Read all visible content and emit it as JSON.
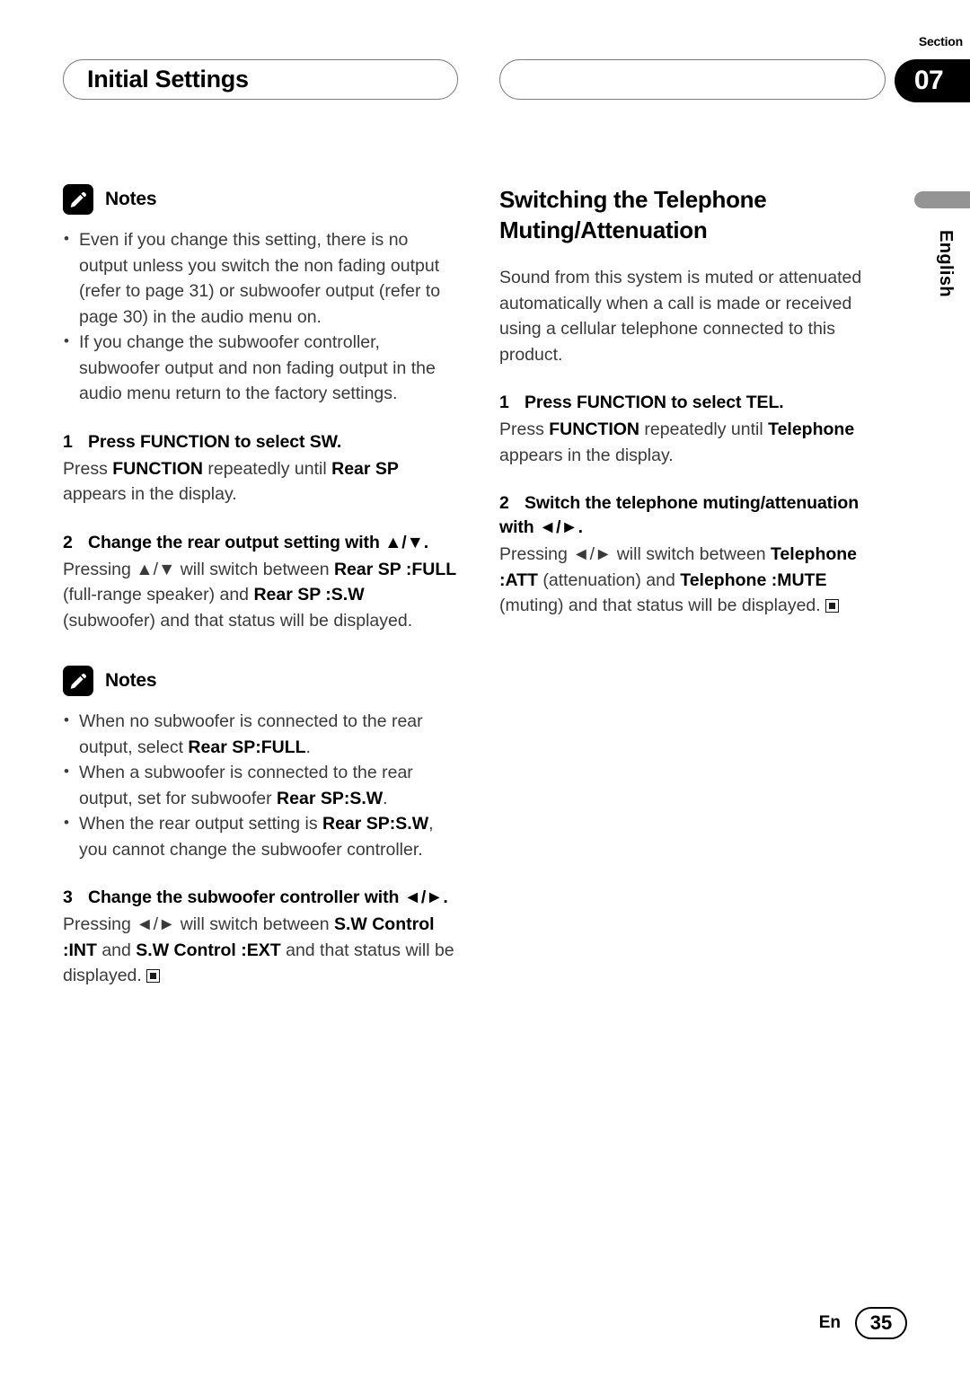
{
  "header": {
    "section_label": "Section",
    "section_number": "07",
    "left_title": "Initial Settings",
    "right_title": ""
  },
  "side_tab": {
    "language": "English"
  },
  "left_column": {
    "notes_1": {
      "icon": "pencil-icon",
      "label": "Notes",
      "bullets": [
        "Even if you change this setting, there is no output unless you switch the non fading output (refer to page 31) or subwoofer output (refer to page 30) in the audio menu on.",
        "If you change the subwoofer controller, subwoofer output and non fading output in the audio menu return to the factory settings."
      ]
    },
    "step_1": {
      "number": "1",
      "heading_parts": [
        {
          "text": "Press ",
          "bold": true
        },
        {
          "text": "FUNCTION",
          "bold": true
        },
        {
          "text": " to select SW.",
          "bold": true
        }
      ],
      "heading": "Press FUNCTION to select SW.",
      "body_html": "Press <b>FUNCTION</b> repeatedly until <b>Rear SP</b> appears in the display."
    },
    "step_2": {
      "number": "2",
      "heading": "Change the rear output setting with ▲/▼.",
      "body_html": "Pressing ▲/▼ will switch between <b>Rear SP :FULL</b> (full-range speaker) and <b>Rear SP :S.W</b> (subwoofer) and that status will be displayed."
    },
    "notes_2": {
      "icon": "pencil-icon",
      "label": "Notes",
      "bullets_html": [
        "When no subwoofer is connected to the rear output, select <b>Rear SP:FULL</b>.",
        "When a subwoofer is connected to the rear output, set for subwoofer <b>Rear SP:S.W</b>.",
        "When the rear output setting is <b>Rear SP:S.W</b>, you cannot change the subwoofer controller."
      ]
    },
    "step_3": {
      "number": "3",
      "heading": "Change the subwoofer controller with ◄/►.",
      "body_html": "Pressing ◄/► will switch between <b>S.W Control :INT</b> and <b>S.W Control :EXT</b> and that status will be displayed."
    }
  },
  "right_column": {
    "heading": "Switching the Telephone Muting/Attenuation",
    "intro": "Sound from this system is muted or attenuated automatically when a call is made or received using a cellular telephone connected to this product.",
    "step_1": {
      "number": "1",
      "heading": "Press FUNCTION to select TEL.",
      "body_html": "Press <b>FUNCTION</b> repeatedly until <b>Telephone</b> appears in the display."
    },
    "step_2": {
      "number": "2",
      "heading": "Switch the telephone muting/attenuation with ◄/►.",
      "body_html": "Pressing ◄/► will switch between <b>Telephone :ATT</b> (attenuation) and <b>Telephone :MUTE</b> (muting) and that status will be displayed."
    }
  },
  "footer": {
    "language_code": "En",
    "page_number": "35"
  }
}
